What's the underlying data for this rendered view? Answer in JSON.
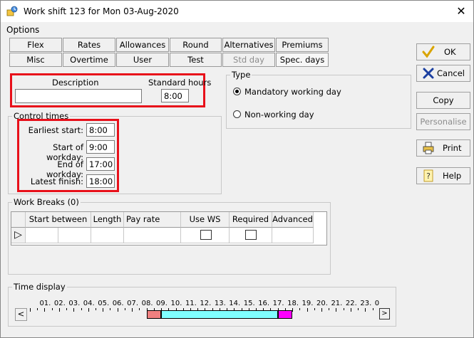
{
  "window": {
    "title": "Work shift 123 for Mon 03-Aug-2020",
    "close_glyph": "✕"
  },
  "options_label": "Options",
  "tabs_row1": [
    "Flex",
    "Rates",
    "Allowances",
    "Round",
    "Alternatives",
    "Premiums"
  ],
  "tabs_row2": [
    "Misc",
    "Overtime",
    "User",
    "Test",
    "Std day",
    "Spec. days"
  ],
  "description": {
    "label": "Description",
    "value": ""
  },
  "standard_hours": {
    "label": "Standard hours",
    "value": "8:00"
  },
  "type": {
    "label": "Type",
    "options": [
      {
        "label": "Mandatory working day",
        "selected": true
      },
      {
        "label": "Non-working day",
        "selected": false
      }
    ]
  },
  "control_times": {
    "label": "Control times",
    "rows": [
      {
        "label": "Earliest start:",
        "value": "8:00"
      },
      {
        "label": "Start of workday:",
        "value": "9:00"
      },
      {
        "label": "End of workday:",
        "value": "17:00"
      },
      {
        "label": "Latest finish:",
        "value": "18:00"
      }
    ]
  },
  "side_buttons": {
    "ok": "OK",
    "cancel": "Cancel",
    "copy": "Copy",
    "personalise": "Personalise",
    "print": "Print",
    "help": "Help"
  },
  "work_breaks": {
    "label": "Work Breaks (0)",
    "columns": [
      "Start between",
      "Length",
      "Pay rate",
      "Use WS rate",
      "Required",
      "Advanced"
    ],
    "row_marker": "▷"
  },
  "time_display": {
    "label": "Time display",
    "hours": [
      "01",
      "02",
      "03",
      "04",
      "05",
      "06",
      "07",
      "08",
      "09",
      "10",
      "11",
      "12",
      "13",
      "14",
      "15",
      "16",
      "17",
      "18",
      "19",
      "20",
      "21",
      "22",
      "23",
      "0"
    ],
    "prev_glyph": "<",
    "next_glyph": ">",
    "flex_start_hour": 8,
    "core_start_hour": 9,
    "core_end_hour": 17,
    "flex_end_hour": 18,
    "colors": {
      "flex_start": "#ef8080",
      "core": "#80ffff",
      "flex_end": "#ff00ff"
    }
  },
  "colors": {
    "highlight": "#e8101a"
  }
}
